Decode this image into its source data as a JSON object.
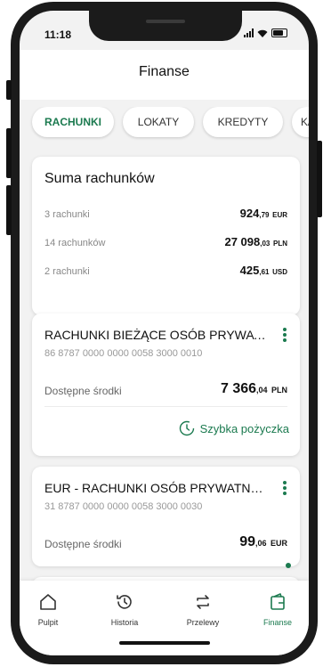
{
  "status": {
    "time": "11:18"
  },
  "header": {
    "title": "Finanse"
  },
  "tabs": [
    {
      "label": "RACHUNKI"
    },
    {
      "label": "LOKATY"
    },
    {
      "label": "KREDYTY"
    },
    {
      "label": "K/"
    }
  ],
  "summary": {
    "title": "Suma rachunków",
    "rows": [
      {
        "label": "3 rachunki",
        "amount_main": "924",
        "amount_dec": ",79",
        "currency": "EUR"
      },
      {
        "label": "14 rachunków",
        "amount_main": "27 098",
        "amount_dec": ",03",
        "currency": "PLN"
      },
      {
        "label": "2 rachunki",
        "amount_main": "425",
        "amount_dec": ",61",
        "currency": "USD"
      }
    ]
  },
  "accounts": [
    {
      "name": "RACHUNKI BIEŻĄCE OSÓB PRYWATNY...",
      "number": "86 8787 0000 0000 0058 3000 0010",
      "avail_label": "Dostępne środki",
      "amount_main": "7 366",
      "amount_dec": ",04",
      "currency": "PLN",
      "link_label": "Szybka pożyczka"
    },
    {
      "name": "EUR - RACHUNKI OSÓB PRYWATNYCH...",
      "number": "31 8787 0000 0000 0058 3000 0030",
      "avail_label": "Dostępne środki",
      "amount_main": "99",
      "amount_dec": ",06",
      "currency": "EUR"
    }
  ],
  "nav": [
    {
      "label": "Pulpit",
      "icon": "home-icon"
    },
    {
      "label": "Historia",
      "icon": "history-icon"
    },
    {
      "label": "Przelewy",
      "icon": "transfer-icon"
    },
    {
      "label": "Finanse",
      "icon": "finance-icon"
    }
  ],
  "colors": {
    "accent": "#1b7a4f",
    "background": "#f2f2f2",
    "phone_frame": "#1b1b1b"
  }
}
